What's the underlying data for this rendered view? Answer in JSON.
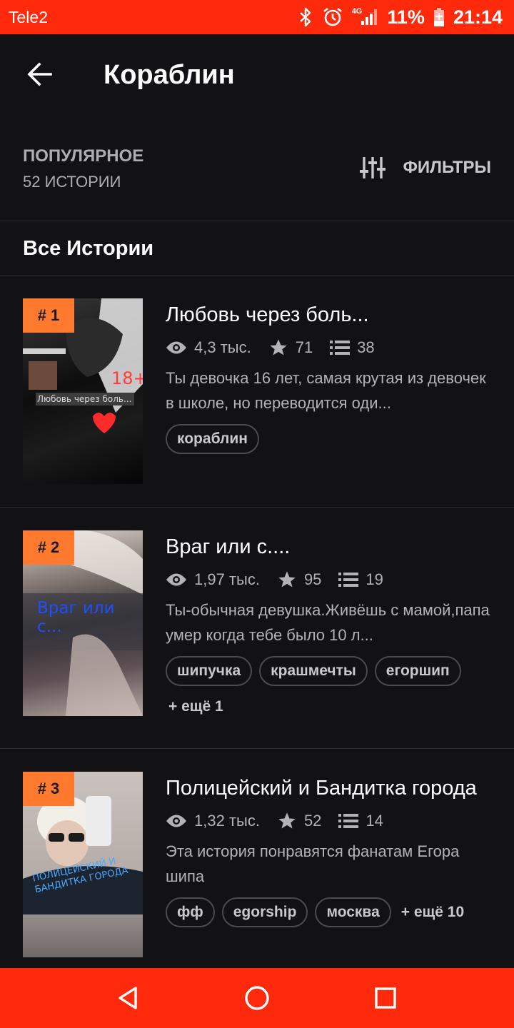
{
  "status_bar": {
    "carrier": "Tele2",
    "network": "4G",
    "battery": "11%",
    "time": "21:14"
  },
  "header": {
    "title": "Кораблин"
  },
  "sort": {
    "label": "ПОПУЛЯРНОЕ",
    "count": "52 ИСТОРИИ",
    "filters_label": "ФИЛЬТРЫ"
  },
  "section": {
    "title": "Все Истории"
  },
  "stories": [
    {
      "rank": "# 1",
      "title": "Любовь через боль...",
      "views": "4,3 тыс.",
      "votes": "71",
      "parts": "38",
      "description": "Ты девочка 16 лет, самая крутая из девочек в школе, но переводится оди...",
      "tags": [
        "кораблин"
      ],
      "more": "",
      "cover_caption": "Любовь через боль...",
      "cover_badge": "18+"
    },
    {
      "rank": "# 2",
      "title": "Враг или с....",
      "views": "1,97 тыс.",
      "votes": "95",
      "parts": "19",
      "description": "Ты-обычная девушка.Живёшь с мамой,папа умер когда тебе было 10 л...",
      "tags": [
        "шипучка",
        "крашмечты",
        "егоршип"
      ],
      "more": "+ ещё 1",
      "cover_caption": "Враг или с..."
    },
    {
      "rank": "# 3",
      "title": "Полицейский и Бандитка города",
      "views": "1,32 тыс.",
      "votes": "52",
      "parts": "14",
      "description": "Эта история понравятся фанатам Егора шипа",
      "tags": [
        "фф",
        "egorship",
        "москва"
      ],
      "more": "+ ещё 10",
      "cover_caption": "ПОЛИЦЕЙСКИЙ И БАНДИТКА ГОРОДА"
    }
  ],
  "colors": {
    "status_bar": "#ff2a0c",
    "background": "#121114",
    "rank_badge": "#ff7a2f",
    "nav_bar": "#ff2a0c"
  },
  "icons": {
    "back": "arrow-left-icon",
    "filters": "sliders-icon",
    "views": "eye-icon",
    "votes": "star-icon",
    "parts": "list-icon"
  }
}
